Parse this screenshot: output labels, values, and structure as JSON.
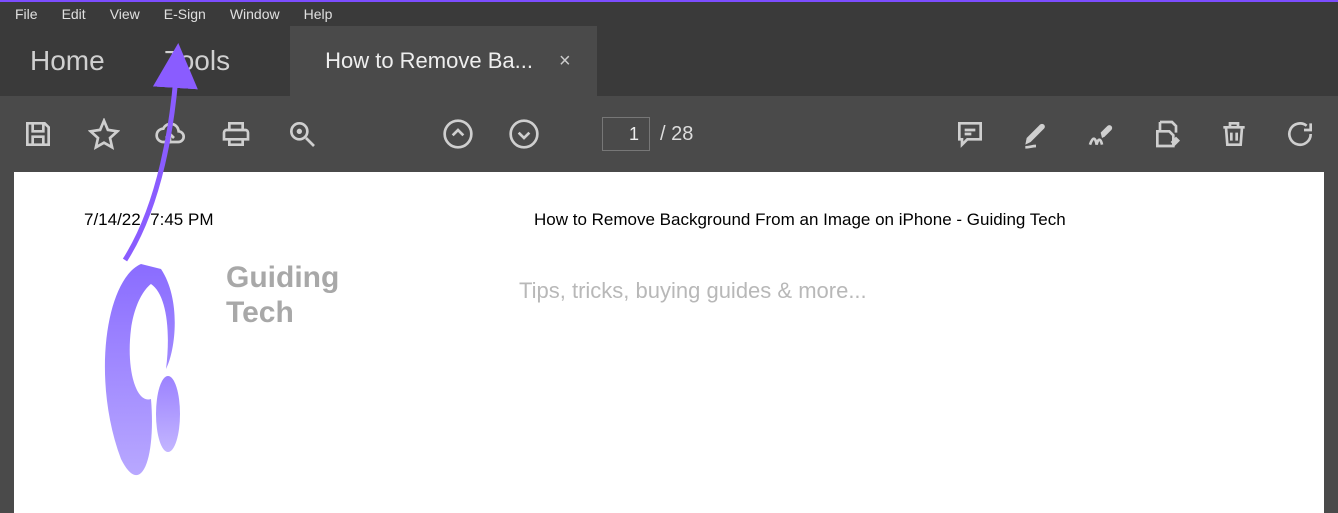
{
  "menubar": {
    "items": [
      "File",
      "Edit",
      "View",
      "E-Sign",
      "Window",
      "Help"
    ]
  },
  "tabs": {
    "home": "Home",
    "tools": "Tools",
    "doc_title": "How to Remove Ba...",
    "close_label": "×"
  },
  "toolbar": {
    "save": "Save",
    "star": "Star",
    "cloud": "Share",
    "print": "Print",
    "zoom": "Zoom",
    "page_up": "Previous page",
    "page_down": "Next page",
    "comment": "Comment",
    "highlight": "Highlight",
    "sign": "Fill & Sign",
    "edit": "Edit",
    "delete": "Delete",
    "rotate": "Rotate"
  },
  "pagenav": {
    "current": "1",
    "total": "/ 28"
  },
  "document": {
    "datetime": "7/14/22, 7:45 PM",
    "title": "How to Remove Background From an Image on iPhone - Guiding Tech",
    "brand_line1": "Guiding",
    "brand_line2": "Tech",
    "tagline": "Tips, tricks, buying guides & more..."
  }
}
